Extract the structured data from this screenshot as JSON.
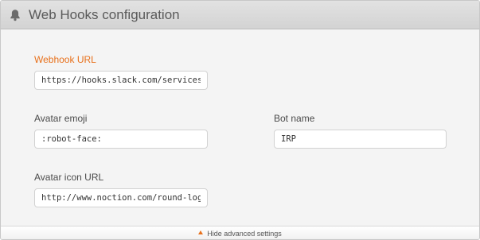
{
  "header": {
    "title": "Web Hooks configuration",
    "icon": "bell-icon"
  },
  "fields": {
    "webhook_url": {
      "label": "Webhook URL",
      "value": "https://hooks.slack.com/services/XXXX"
    },
    "avatar_emoji": {
      "label": "Avatar emoji",
      "value": ":robot-face:"
    },
    "bot_name": {
      "label": "Bot name",
      "value": "IRP"
    },
    "avatar_icon_url": {
      "label": "Avatar icon URL",
      "value": "http://www.noction.com/round-logo.png"
    }
  },
  "footer": {
    "toggle_label": "Hide advanced settings",
    "icon": "triangle-up-icon"
  },
  "colors": {
    "accent": "#e8711c",
    "header_bg": "#d8d8d8",
    "body_bg": "#f4f4f4"
  }
}
